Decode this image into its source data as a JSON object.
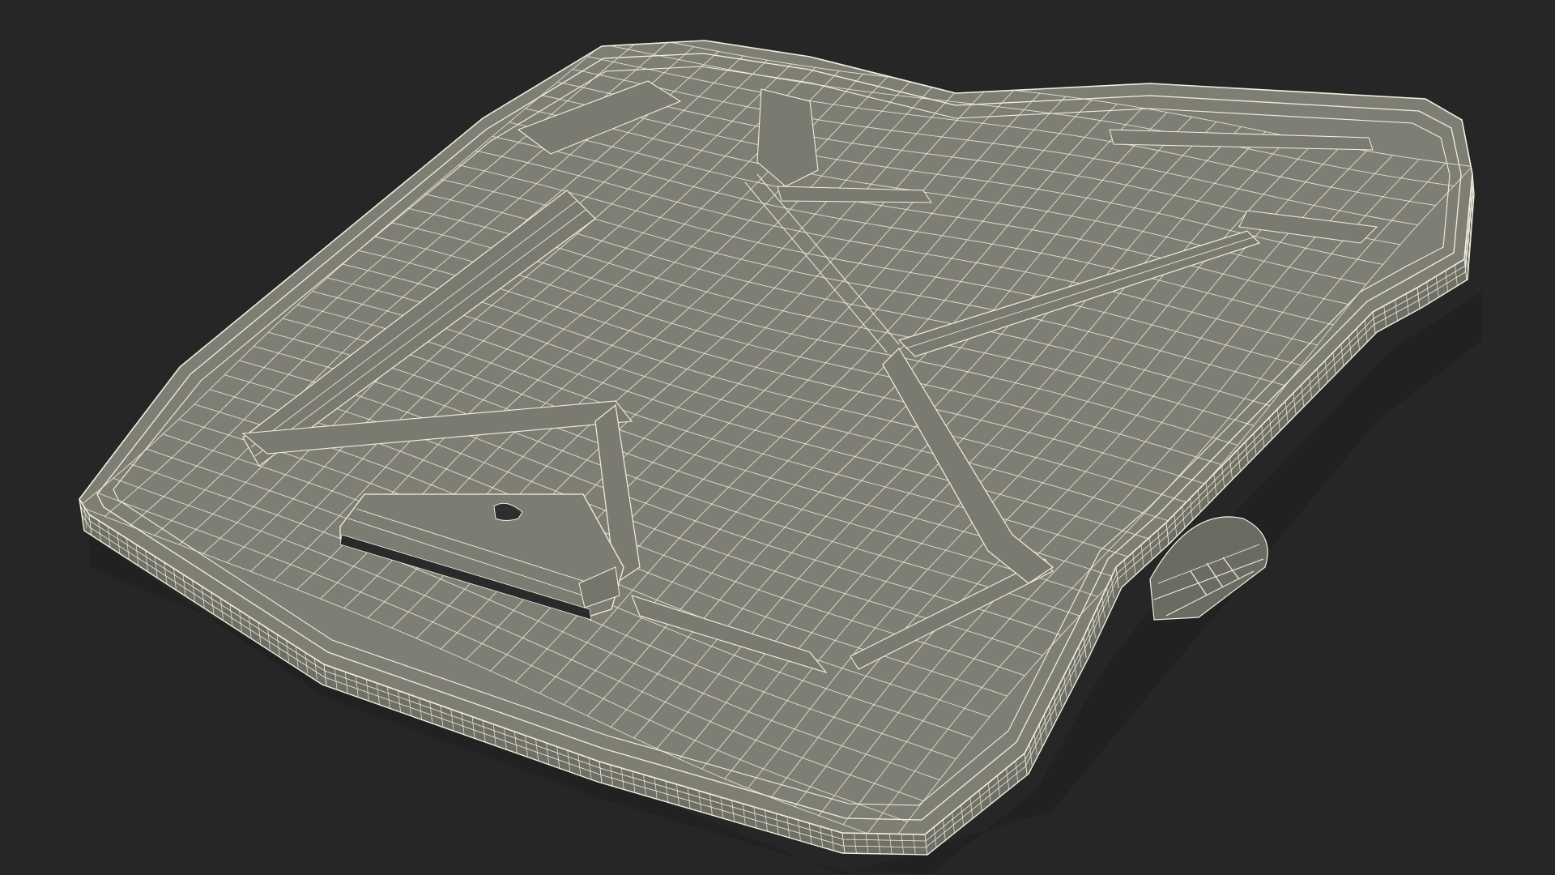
{
  "scene": {
    "background_color": "#262626",
    "surface_color": "#7e7e74",
    "side_color": "#6f6f66",
    "rib_color": "#74746b",
    "wire_color": "#f1f0de",
    "shadow_color": "#1c1c1c",
    "icon": "wireframe-laptop-cooling-pad"
  }
}
